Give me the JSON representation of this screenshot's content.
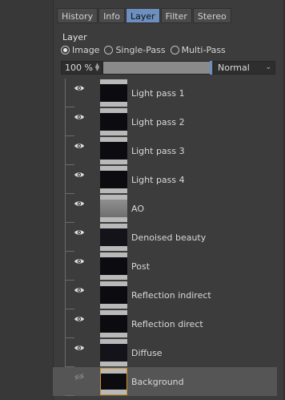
{
  "tabs": [
    {
      "label": "History",
      "active": false
    },
    {
      "label": "Info",
      "active": false
    },
    {
      "label": "Layer",
      "active": true
    },
    {
      "label": "Filter",
      "active": false
    },
    {
      "label": "Stereo",
      "active": false
    }
  ],
  "layer_panel": {
    "title": "Layer",
    "modes": [
      {
        "label": "Image",
        "checked": true
      },
      {
        "label": "Single-Pass",
        "checked": false
      },
      {
        "label": "Multi-Pass",
        "checked": false
      }
    ],
    "opacity": "100 %",
    "blend_mode": "Normal"
  },
  "layers": [
    {
      "name": "Light pass 1",
      "visible": true
    },
    {
      "name": "Light pass 2",
      "visible": true
    },
    {
      "name": "Light pass 3",
      "visible": true
    },
    {
      "name": "Light pass 4",
      "visible": true
    },
    {
      "name": "AO",
      "visible": true
    },
    {
      "name": "Denoised beauty",
      "visible": true
    },
    {
      "name": "Post",
      "visible": true
    },
    {
      "name": "Reflection indirect",
      "visible": true
    },
    {
      "name": "Reflection direct",
      "visible": true
    },
    {
      "name": "Diffuse",
      "visible": true
    },
    {
      "name": "Background",
      "visible": false,
      "selected": true
    }
  ],
  "colors": {
    "accent": "#6d8fbf",
    "selection_border": "#d0902a",
    "panel_bg": "#3c3c3c"
  },
  "icons": {
    "visibility": "eye-icon",
    "stepper": "stepper-icon",
    "dropdown": "chevron-down-icon"
  }
}
